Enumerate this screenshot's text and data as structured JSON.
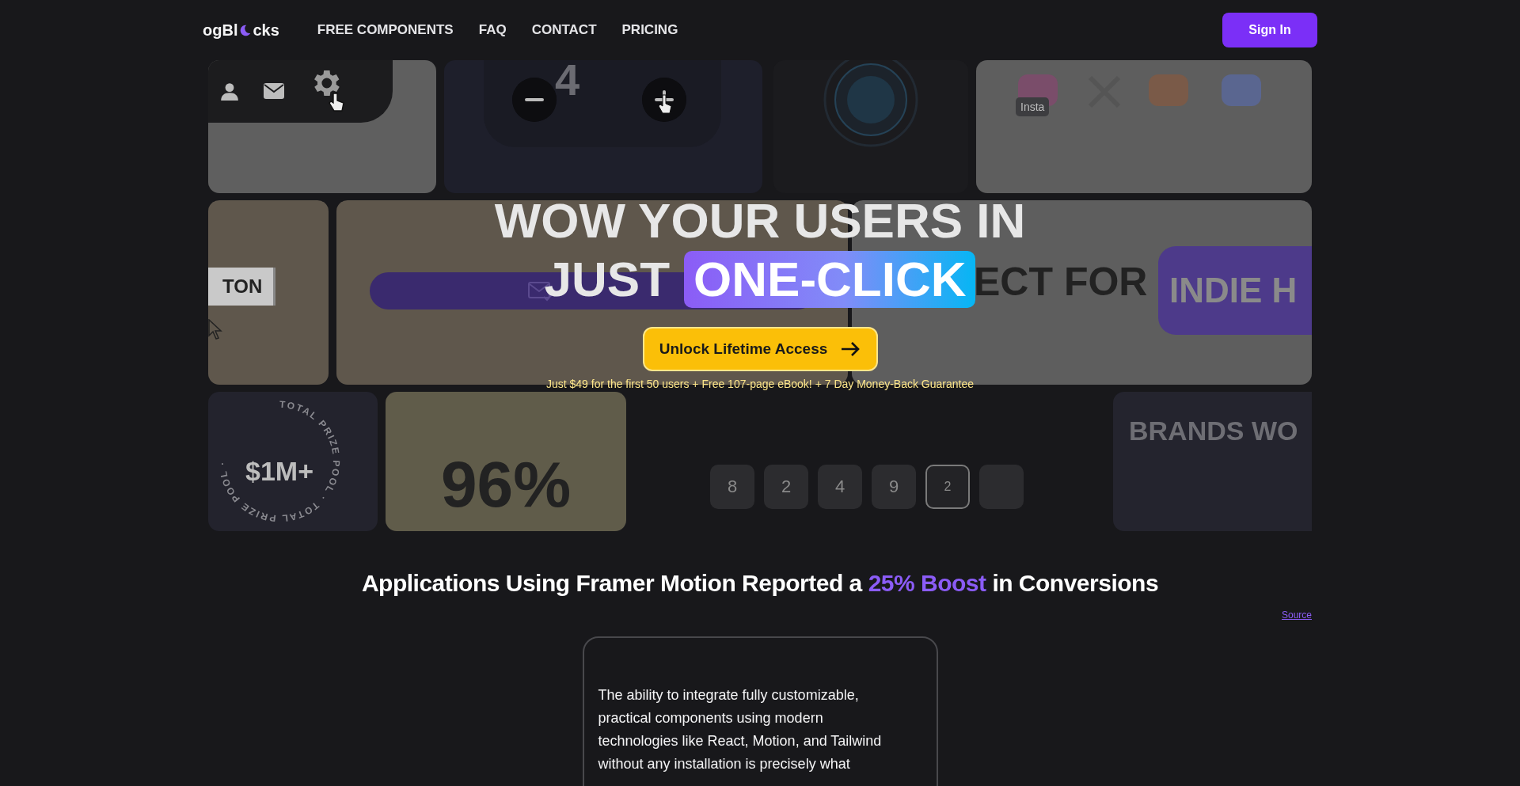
{
  "nav": {
    "logo_left": "ogBl",
    "logo_right": "cks",
    "links": [
      "FREE COMPONENTS",
      "FAQ",
      "CONTACT",
      "PRICING"
    ],
    "sign_in": "Sign In"
  },
  "collage": {
    "counter_digit": "4",
    "tooltip": "Insta",
    "button_text": "TON",
    "perfect_for": "ECT FOR",
    "tag": "INDIE H",
    "prize_ring": "TOTAL PRIZE POOL · TOTAL PRIZE POOL ·",
    "prize": "$1M+",
    "percent": "96%",
    "digits": [
      {
        "value": "8",
        "selected": false
      },
      {
        "value": "2",
        "selected": false
      },
      {
        "value": "4",
        "selected": false
      },
      {
        "value": "9",
        "selected": false
      },
      {
        "value": "2",
        "selected": true
      },
      {
        "selected": false
      }
    ],
    "brands": "BRANDS WO"
  },
  "hero": {
    "headline_line1": "WOW YOUR USERS IN",
    "headline_just": "JUST",
    "headline_highlight": "ONE-CLICK",
    "cta": "Unlock Lifetime Access",
    "offer": "Just $49 for the first 50 users + Free 107-page eBook! + 7 Day Money-Back Guarantee"
  },
  "stats": {
    "heading_before": "Applications Using Framer Motion Reported a",
    "heading_highlight": "25% Boost",
    "heading_after": "in Conversions",
    "source": "Source",
    "quote": "The ability to integrate fully customizable, practical components using modern technologies like React, Motion, and Tailwind without any installation is precisely what"
  }
}
